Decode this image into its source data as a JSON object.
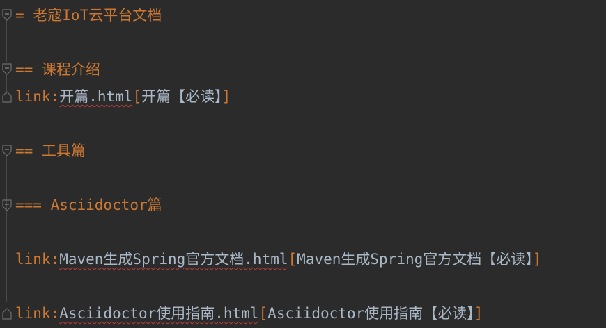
{
  "editor": {
    "icons": {
      "fold_start": "fold-open-icon",
      "fold_end": "fold-close-icon"
    },
    "colors": {
      "background": "#2b2b2b",
      "keyword": "#cc7832",
      "text": "#a9b7c6",
      "spellcheck": "#bc3f3c"
    },
    "lines": {
      "l1": {
        "heading": "= 老寇IoT云平台文档"
      },
      "l2": {
        "heading": "== 课程介绍"
      },
      "l3": {
        "prefix": "link:",
        "target": "开篇.html",
        "open": "[",
        "label": "开篇【必读】",
        "close": "]"
      },
      "l4": {
        "heading": "== 工具篇"
      },
      "l5": {
        "heading": "=== Asciidoctor篇"
      },
      "l6": {
        "prefix": "link:",
        "target": "Maven生成Spring官方文档.html",
        "open": "[",
        "label": "Maven生成Spring官方文档【必读】",
        "close": "]"
      },
      "l7": {
        "prefix": "link:",
        "target": "Asciidoctor使用指南.html",
        "open": "[",
        "label": "Asciidoctor使用指南【必读】",
        "close": "]"
      }
    }
  }
}
